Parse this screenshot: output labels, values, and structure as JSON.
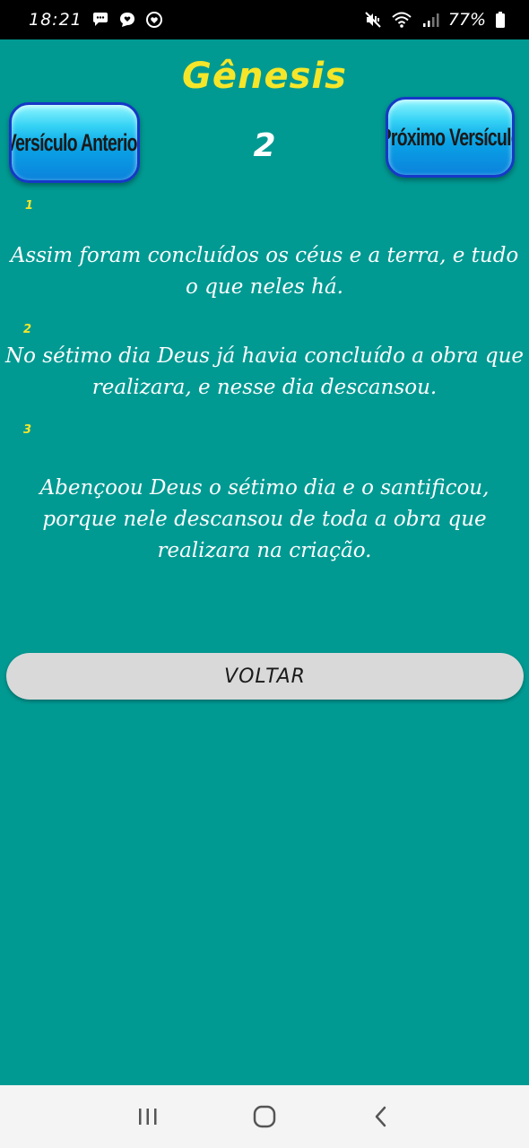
{
  "status_bar": {
    "time": "18:21",
    "battery": "77%"
  },
  "app": {
    "book": "Gênesis",
    "chapter": "2",
    "prev_label": "Versículo Anterior",
    "next_label": "Próximo Versículo",
    "verses": [
      {
        "number": "1",
        "text": "Assim foram concluídos os céus e a terra, e tudo o que neles há."
      },
      {
        "number": "2",
        "text": "No sétimo dia Deus já havia concluído a obra que realizara, e nesse dia descansou."
      },
      {
        "number": "3",
        "text": "Abençoou Deus o sétimo dia e o santificou, porque nele descansou de toda a obra que realizara na criação."
      }
    ],
    "back_label": "VOLTAR"
  },
  "colors": {
    "background": "#009a93",
    "title": "#f5e62a",
    "verse_number": "#f5e62a",
    "button_blue": "#0aa4e6",
    "back_button": "#d9d9d9"
  },
  "icons": {
    "status_left": [
      "chat-bubble-icon",
      "heart-bubble-icon",
      "heart-circle-icon"
    ],
    "status_right": [
      "mute-vibrate-icon",
      "wifi-icon",
      "signal-icon",
      "battery-icon"
    ],
    "nav": [
      "recent-apps-icon",
      "home-icon",
      "back-icon"
    ]
  }
}
